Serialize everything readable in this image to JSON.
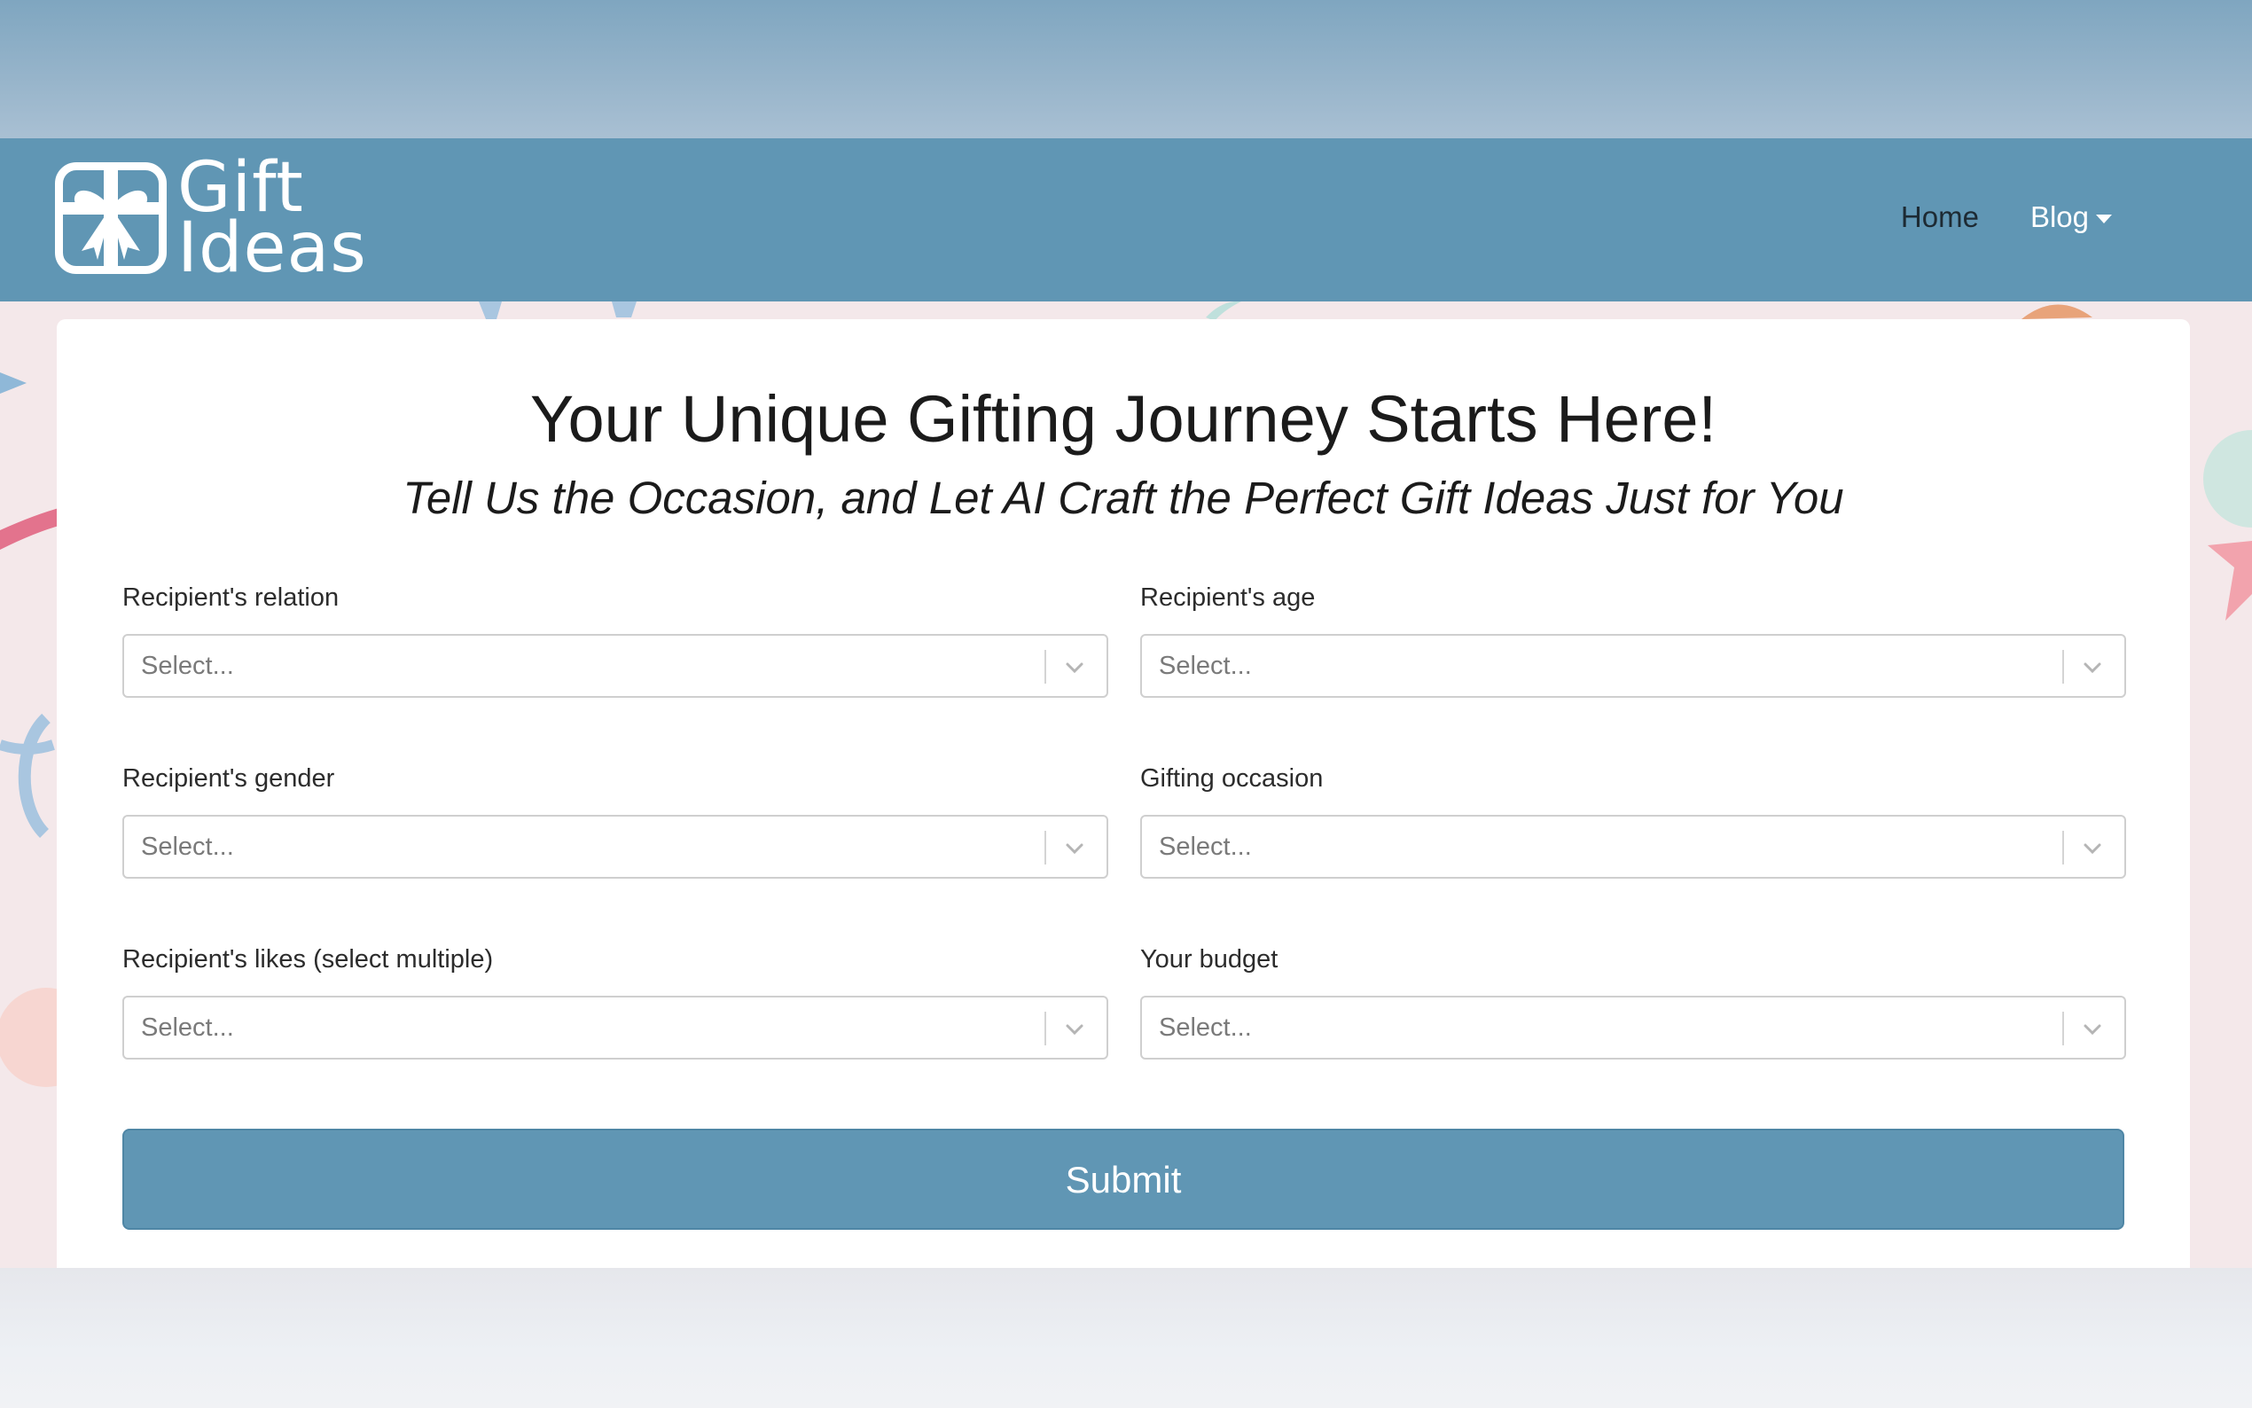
{
  "header": {
    "logo_line1": "Gift",
    "logo_line2": "Ideas",
    "nav": {
      "home": "Home",
      "blog": "Blog"
    }
  },
  "main": {
    "title": "Your Unique Gifting Journey Starts Here!",
    "subtitle": "Tell Us the Occasion, and Let AI Craft the Perfect Gift Ideas Just for You",
    "fields": [
      {
        "label": "Recipient's relation",
        "placeholder": "Select..."
      },
      {
        "label": "Recipient's age",
        "placeholder": "Select..."
      },
      {
        "label": "Recipient's gender",
        "placeholder": "Select..."
      },
      {
        "label": "Gifting occasion",
        "placeholder": "Select..."
      },
      {
        "label": "Recipient's likes (select multiple)",
        "placeholder": "Select..."
      },
      {
        "label": "Your budget",
        "placeholder": "Select..."
      }
    ],
    "submit_label": "Submit"
  },
  "colors": {
    "brand": "#6096b4",
    "page_background": "#f4e8ea",
    "card": "#ffffff"
  },
  "icons": [
    "gift-box-logo-icon",
    "caret-down-icon",
    "chevron-down-icon"
  ]
}
